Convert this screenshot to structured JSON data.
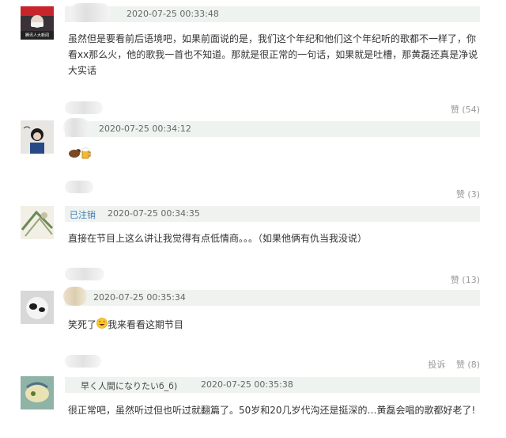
{
  "comments": [
    {
      "user": "",
      "time": "2020-07-25 00:33:48",
      "avatar_caption": "腾讯人大新闻",
      "text": "虽然但是要看前后语境吧，如果前面说的是，我们这个年纪和他们这个年纪听的歌都不一样了，你看xx那么火，他的歌我一首也不知道。那就是很正常的一句话，如果就是吐槽，那黄磊还真是净说大实话",
      "like_label": "赞",
      "like_count": "(54)"
    },
    {
      "user": "",
      "time": "2020-07-25 00:34:12",
      "text": "",
      "emoji": [
        "bear-icon",
        "beer-icon"
      ],
      "like_label": "赞",
      "like_count": "(3)"
    },
    {
      "user": "已注销",
      "time": "2020-07-25 00:34:35",
      "text": "直接在节目上这么讲让我觉得有点低情商。。。（如果他俩有仇当我没说）",
      "like_label": "赞",
      "like_count": "(13)"
    },
    {
      "user": "",
      "time": "2020-07-25 00:35:34",
      "text_before": "笑死了",
      "emoji": [
        "laughing-face-icon"
      ],
      "text_after": "我来看看这期节目",
      "report_label": "投诉",
      "like_label": "赞",
      "like_count": "(8)"
    },
    {
      "user": "早く人間になりたいϭ_ϭ)",
      "time": "2020-07-25 00:35:38",
      "text": "很正常吧，虽然听过但也听过就翻篇了。50岁和20几岁代沟还是挺深的…黄磊会唱的歌都好老了!"
    }
  ],
  "colors": {
    "meta_bg": "#eef3ef",
    "link": "#3f7ab6",
    "muted": "#999999"
  }
}
